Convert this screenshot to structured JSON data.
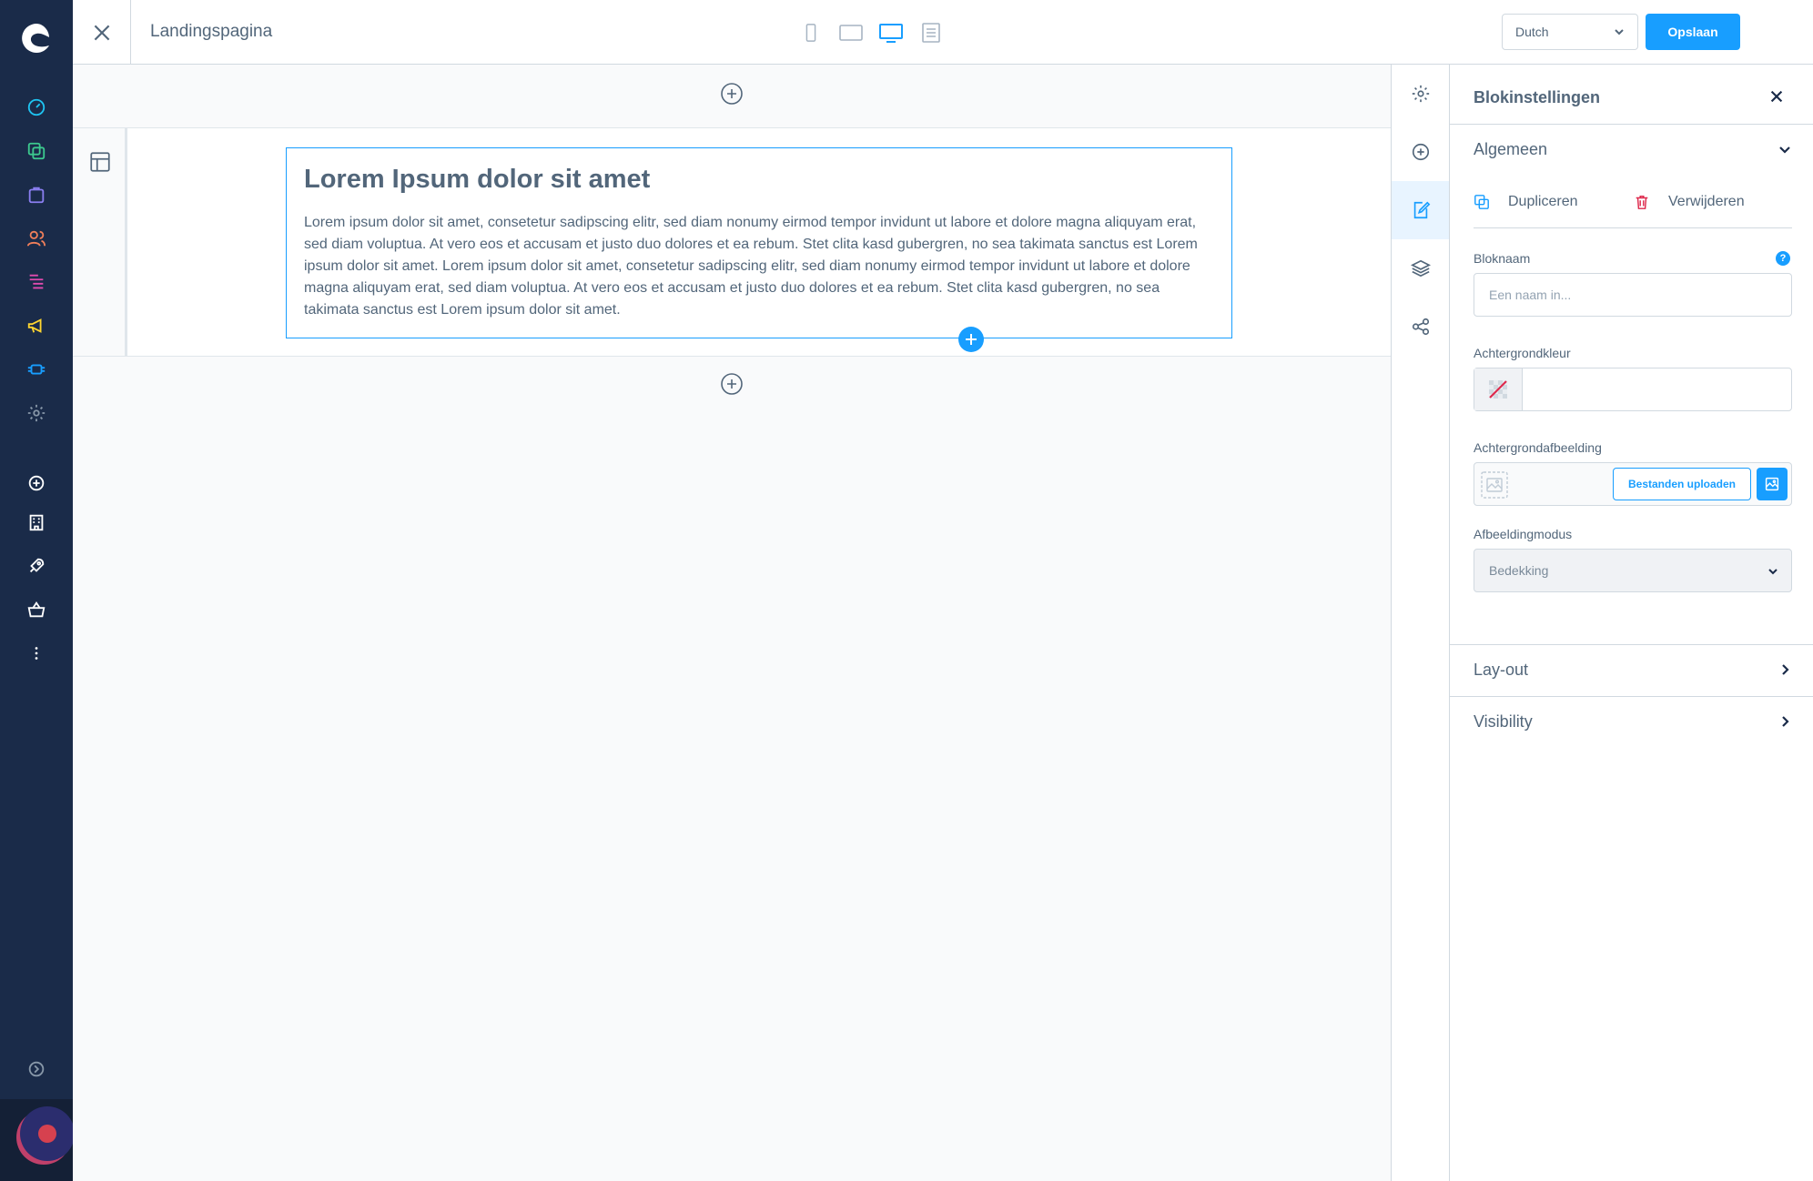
{
  "app": {
    "page_title": "Landingspagina"
  },
  "topbar": {
    "language": "Dutch",
    "save_label": "Opslaan",
    "devices": [
      "mobile-icon",
      "tablet-icon",
      "desktop-icon",
      "list-icon"
    ],
    "active_device": "desktop-icon"
  },
  "leftnav": {
    "items": [
      "dashboard-icon",
      "catalogue-icon",
      "orders-icon",
      "customers-icon",
      "content-icon",
      "marketing-icon",
      "extensions-icon",
      "settings-icon",
      "add-icon",
      "store-icon",
      "rocket-icon",
      "basket-icon",
      "more-icon",
      "expand-icon"
    ]
  },
  "canvas": {
    "block": {
      "heading": "Lorem Ipsum dolor sit amet",
      "body": "Lorem ipsum dolor sit amet, consetetur sadipscing elitr, sed diam nonumy eirmod tempor invidunt ut labore et dolore magna aliquyam erat, sed diam voluptua. At vero eos et accusam et justo duo dolores et ea rebum. Stet clita kasd gubergren, no sea takimata sanctus est Lorem ipsum dolor sit amet. Lorem ipsum dolor sit amet, consetetur sadipscing elitr, sed diam nonumy eirmod tempor invidunt ut labore et dolore magna aliquyam erat, sed diam voluptua. At vero eos et accusam et justo duo dolores et ea rebum. Stet clita kasd gubergren, no sea takimata sanctus est Lorem ipsum dolor sit amet."
    }
  },
  "rail": {
    "items": [
      "settings-icon",
      "add-block-icon",
      "edit-icon",
      "layers-icon",
      "share-icon"
    ],
    "active": "edit-icon"
  },
  "panel": {
    "title": "Blokinstellingen",
    "general": {
      "label": "Algemeen",
      "duplicate_label": "Dupliceren",
      "delete_label": "Verwijderen",
      "name_label": "Bloknaam",
      "name_placeholder": "Een naam in...",
      "bg_color_label": "Achtergrondkleur",
      "bg_image_label": "Achtergrondafbeelding",
      "upload_label": "Bestanden uploaden",
      "image_mode_label": "Afbeeldingmodus",
      "image_mode_value": "Bedekking"
    },
    "layout_label": "Lay-out",
    "visibility_label": "Visibility"
  },
  "colors": {
    "accent": "#189eff",
    "sidebar": "#1a2b49",
    "text": "#52667a"
  }
}
